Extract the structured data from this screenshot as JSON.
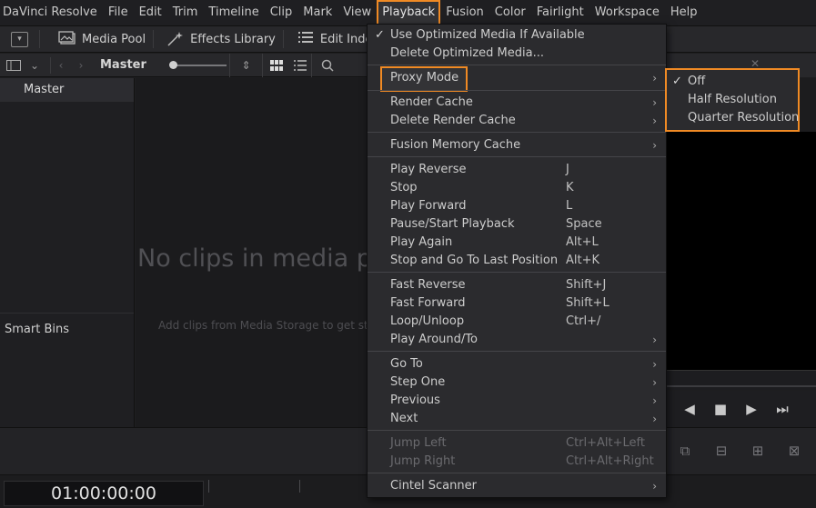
{
  "menubar": {
    "items": [
      "DaVinci Resolve",
      "File",
      "Edit",
      "Trim",
      "Timeline",
      "Clip",
      "Mark",
      "View",
      "Playback",
      "Fusion",
      "Color",
      "Fairlight",
      "Workspace",
      "Help"
    ],
    "active": "Playback"
  },
  "toolbar": {
    "media_pool": "Media Pool",
    "effects_library": "Effects Library",
    "edit_index": "Edit Inde"
  },
  "binbar": {
    "crumb": "Master"
  },
  "bins": {
    "master": "Master",
    "smart_bins": "Smart Bins"
  },
  "media": {
    "empty_title": "No clips in media po",
    "empty_hint": "Add clips from Media Storage to get start"
  },
  "playback_menu": {
    "use_optimized": "Use Optimized Media If Available",
    "delete_optimized": "Delete Optimized Media...",
    "proxy_mode": "Proxy Mode",
    "render_cache": "Render Cache",
    "delete_render_cache": "Delete Render Cache",
    "fusion_memory_cache": "Fusion Memory Cache",
    "play_reverse": "Play Reverse",
    "play_reverse_sc": "J",
    "stop": "Stop",
    "stop_sc": "K",
    "play_forward": "Play Forward",
    "play_forward_sc": "L",
    "pause_start": "Pause/Start Playback",
    "pause_start_sc": "Space",
    "play_again": "Play Again",
    "play_again_sc": "Alt+L",
    "stop_go_last": "Stop and Go To Last Position",
    "stop_go_last_sc": "Alt+K",
    "fast_reverse": "Fast Reverse",
    "fast_reverse_sc": "Shift+J",
    "fast_forward": "Fast Forward",
    "fast_forward_sc": "Shift+L",
    "loop_unloop": "Loop/Unloop",
    "loop_unloop_sc": "Ctrl+/",
    "play_around": "Play Around/To",
    "go_to": "Go To",
    "step_one": "Step One",
    "previous": "Previous",
    "next": "Next",
    "jump_left": "Jump Left",
    "jump_left_sc": "Ctrl+Alt+Left",
    "jump_right": "Jump Right",
    "jump_right_sc": "Ctrl+Alt+Right",
    "cintel_scanner": "Cintel Scanner"
  },
  "proxy_submenu": {
    "off": "Off",
    "half": "Half Resolution",
    "quarter": "Quarter Resolution",
    "selected": "Off"
  },
  "timecode": "01:00:00:00",
  "accent_color": "#f08a24"
}
